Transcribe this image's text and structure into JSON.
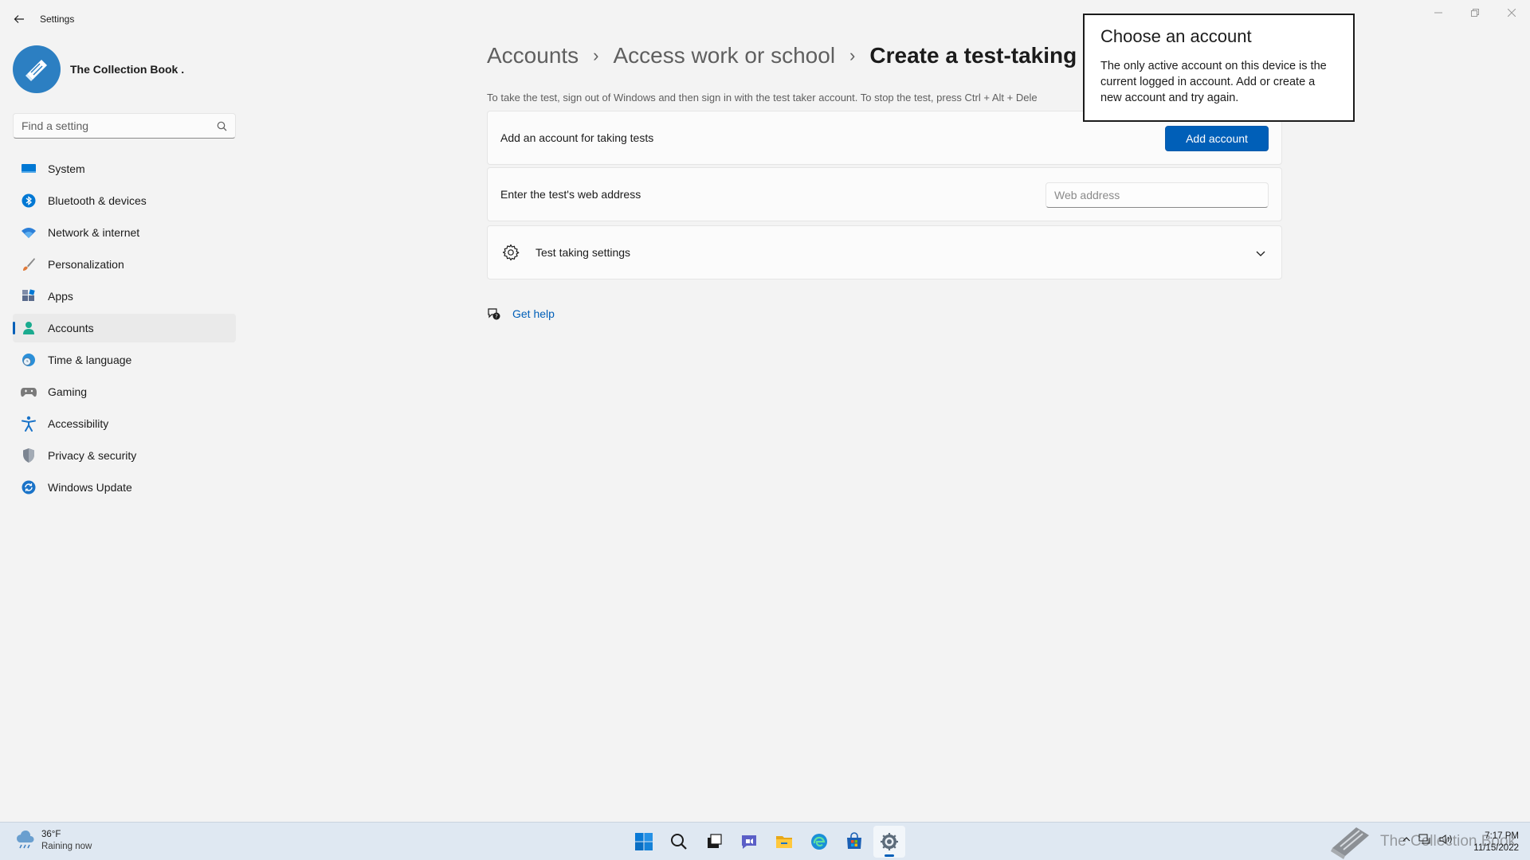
{
  "window": {
    "app_title": "Settings",
    "back_icon": "arrow-left-icon",
    "controls": [
      "minimize-icon",
      "restore-icon",
      "close-icon"
    ]
  },
  "profile": {
    "name": "The Collection Book ."
  },
  "search": {
    "placeholder": "Find a setting",
    "value": ""
  },
  "sidebar": {
    "items": [
      {
        "label": "System",
        "icon": "monitor-icon",
        "color": "#0078d4"
      },
      {
        "label": "Bluetooth & devices",
        "icon": "bluetooth-icon",
        "color": "#0078d4"
      },
      {
        "label": "Network & internet",
        "icon": "wifi-icon",
        "color": "#2b7fd8"
      },
      {
        "label": "Personalization",
        "icon": "brush-icon",
        "color": "#e07a3a"
      },
      {
        "label": "Apps",
        "icon": "apps-icon",
        "color": "#5a6b8c"
      },
      {
        "label": "Accounts",
        "icon": "person-icon",
        "color": "#1bab8f",
        "active": true
      },
      {
        "label": "Time & language",
        "icon": "globe-clock-icon",
        "color": "#2b8fd8"
      },
      {
        "label": "Gaming",
        "icon": "gamepad-icon",
        "color": "#7a7a7a"
      },
      {
        "label": "Accessibility",
        "icon": "accessibility-icon",
        "color": "#1a73c8"
      },
      {
        "label": "Privacy & security",
        "icon": "shield-icon",
        "color": "#7c8591"
      },
      {
        "label": "Windows Update",
        "icon": "update-icon",
        "color": "#1a73c8"
      }
    ]
  },
  "main": {
    "breadcrumb": [
      "Accounts",
      "Access work or school",
      "Create a test-taking a"
    ],
    "description": "To take the test, sign out of Windows and then sign in with the test taker account. To stop the test, press Ctrl + Alt + Dele",
    "cards": {
      "add_account": {
        "label": "Add an account for taking tests",
        "button": "Add account"
      },
      "web_address": {
        "label": "Enter the test's web address",
        "placeholder": "Web address",
        "value": ""
      },
      "settings": {
        "label": "Test taking settings"
      }
    },
    "help": "Get help"
  },
  "flyout": {
    "title": "Choose an account",
    "message": "The only active account on this device is the current logged in account. Add or create a new account and try again."
  },
  "taskbar": {
    "weather": {
      "temp": "36°F",
      "condition": "Raining now"
    },
    "apps": [
      "start-icon",
      "search-icon",
      "task-view-icon",
      "chat-icon",
      "file-explorer-icon",
      "edge-icon",
      "store-icon",
      "settings-icon"
    ],
    "watermark": "The Collection Book",
    "clock": {
      "time": "7:17 PM",
      "date": "11/15/2022"
    }
  },
  "colors": {
    "accent": "#005fb8",
    "background": "#f3f3f3",
    "card": "#fbfbfb",
    "taskbar": "#dfe8f2"
  }
}
